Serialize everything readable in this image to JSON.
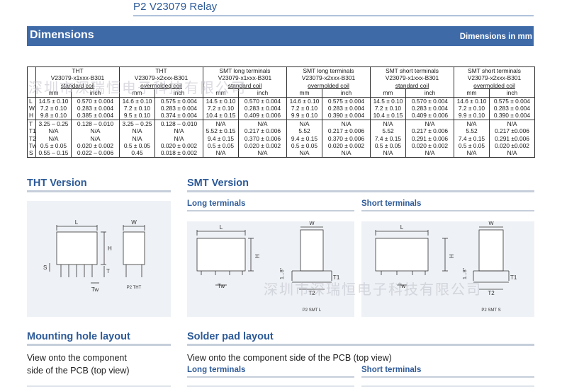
{
  "header": {
    "title": "P2 V23079 Relay"
  },
  "dimensions": {
    "heading": "Dimensions",
    "units_note": "Dimensions in mm",
    "table": {
      "group_titles": [
        "THT",
        "THT",
        "SMT long terminals",
        "SMT long terminals",
        "SMT short terminals",
        "SMT short terminals"
      ],
      "group_parts": [
        "V23079-x1xxx-B301",
        "V23079-x2xxx-B301",
        "V23079-x1xxx-B301",
        "V23079-x2xxx-B301",
        "V23079-x1xxx-B301",
        "V23079-x2xxx-B301"
      ],
      "group_coils": [
        "standard coil",
        "overmolded coil",
        "standard coil",
        "overmolded coil",
        "standard coil",
        "overmolded coil"
      ],
      "unit_labels": [
        "mm",
        "inch",
        "mm",
        "inch",
        "mm",
        "inch",
        "mm",
        "inch",
        "mm",
        "inch",
        "mm",
        "inch"
      ],
      "rows": [
        {
          "label": "L",
          "cells": [
            "14.5 ± 0.10",
            "0.570 ± 0.004",
            "14.6 ± 0.10",
            "0.575 ± 0.004",
            "14.5 ± 0.10",
            "0.570 ± 0.004",
            "14.6 ± 0.10",
            "0.575 ± 0.004",
            "14.5 ± 0.10",
            "0.570 ± 0.004",
            "14.6 ± 0.10",
            "0.575 ± 0.004"
          ]
        },
        {
          "label": "W",
          "cells": [
            "7.2 ± 0.10",
            "0.283 ± 0.004",
            "7.2 ± 0.10",
            "0.283 ± 0.004",
            "7.2 ± 0.10",
            "0.283 ± 0.004",
            "7.2 ± 0.10",
            "0.283 ± 0.004",
            "7.2 ± 0.10",
            "0.283 ± 0.004",
            "7.2 ± 0.10",
            "0.283 ± 0.004"
          ]
        },
        {
          "label": "H",
          "cells": [
            "9.8 ± 0.10",
            "0.385 ± 0.004",
            "9.5 ± 0.10",
            "0.374 ± 0.004",
            "10.4 ± 0.15",
            "0.409 ± 0.006",
            "9.9 ± 0.10",
            "0.390 ± 0.004",
            "10.4 ± 0.15",
            "0.409 ± 0.006",
            "9.9 ± 0.10",
            "0.390 ± 0.004"
          ]
        },
        {
          "label": "T",
          "cells": [
            "3.25 – 0.25",
            "0.128 – 0.010",
            "3.25 – 0.25",
            "0.128 – 0.010",
            "N/A",
            "N/A",
            "N/A",
            "N/A",
            "N/A",
            "N/A",
            "N/A",
            "N/A"
          ]
        },
        {
          "label": "T1",
          "cells": [
            "N/A",
            "N/A",
            "N/A",
            "N/A",
            "5.52 ± 0.15",
            "0.217 ± 0.006",
            "5.52",
            "0.217 ± 0.006",
            "5.52",
            "0.217 ± 0.006",
            "5.52",
            "0.217 ±0.006"
          ]
        },
        {
          "label": "T2",
          "cells": [
            "N/A",
            "N/A",
            "N/A",
            "N/A",
            "9.4 ± 0.15",
            "0.370 ± 0.006",
            "9.4 ± 0.15",
            "0.370 ± 0.006",
            "7.4 ± 0.15",
            "0.291 ± 0.006",
            "7.4 ± 0.15",
            "0.291 ±0.006"
          ]
        },
        {
          "label": "Tw",
          "cells": [
            "0.5 ± 0.05",
            "0.020 ± 0.002",
            "0.5 ± 0.05",
            "0.020 ± 0.002",
            "0.5 ± 0.05",
            "0.020 ± 0.002",
            "0.5 ± 0.05",
            "0.020 ± 0.002",
            "0.5 ± 0.05",
            "0.020 ± 0.002",
            "0.5 ± 0.05",
            "0.020 ±0.002"
          ]
        },
        {
          "label": "S",
          "cells": [
            "0.55 – 0.15",
            "0.022 – 0.006",
            "0.45",
            "0.018 ± 0.002",
            "N/A",
            "N/A",
            "N/A",
            "N/A",
            "N/A",
            "N/A",
            "N/A",
            "N/A"
          ]
        }
      ]
    }
  },
  "tht_version": {
    "heading": "THT Version",
    "labels": {
      "L": "L",
      "W": "W",
      "H": "H",
      "T": "T",
      "S": "S",
      "Tw": "Tw",
      "caption": "P2 THT"
    }
  },
  "smt_version": {
    "heading": "SMT Version",
    "long": {
      "heading": "Long terminals",
      "labels": {
        "L": "L",
        "W": "W",
        "H": "H",
        "angle": "1...8°",
        "Tw": "Tw",
        "T1": "T1",
        "T2": "T2",
        "caption": "P2 SMT L"
      }
    },
    "short": {
      "heading": "Short terminals",
      "labels": {
        "L": "L",
        "W": "W",
        "H": "H",
        "angle": "1...8°",
        "Tw": "Tw",
        "T1": "T1",
        "T2": "T2",
        "caption": "P2 SMT S"
      }
    }
  },
  "mounting": {
    "heading": "Mounting hole layout",
    "text_line1": "View onto the component",
    "text_line2": "side of the PCB (top view)"
  },
  "solder": {
    "heading": "Solder pad layout",
    "text": "View onto the component side of the PCB (top view)",
    "long_heading": "Long terminals",
    "short_heading": "Short terminals"
  },
  "watermarks": [
    "深圳市深瑞恒电子科技有限公司",
    "深圳市深瑞恒电子科技有限公司"
  ],
  "colors": {
    "accent": "#2d5a98",
    "bar": "#3e6aa8",
    "panel": "#eef1f5",
    "rule": "#c5ceda"
  }
}
